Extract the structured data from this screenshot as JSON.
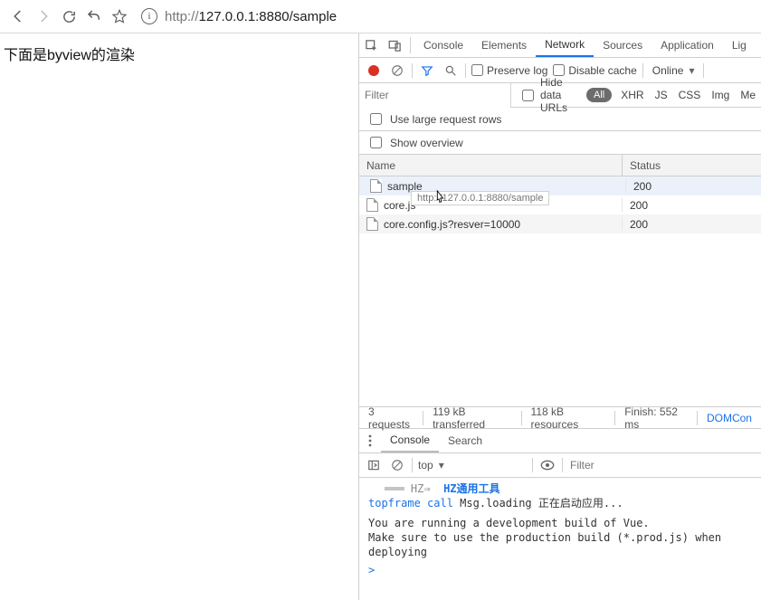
{
  "browser": {
    "url_protocol": "http://",
    "url_rest": "127.0.0.1:8880/sample"
  },
  "page": {
    "body_text": "下面是byview的渲染"
  },
  "devtools": {
    "tabs": {
      "console": "Console",
      "elements": "Elements",
      "network": "Network",
      "sources": "Sources",
      "application": "Application",
      "lighthouse": "Lig"
    },
    "toolbar": {
      "preserve_log": "Preserve log",
      "disable_cache": "Disable cache",
      "throttle": "Online"
    },
    "filter": {
      "placeholder": "Filter",
      "hide_data_urls": "Hide data URLs",
      "pill_all": "All",
      "type_xhr": "XHR",
      "type_js": "JS",
      "type_css": "CSS",
      "type_img": "Img",
      "type_media": "Me"
    },
    "options": {
      "use_large": "Use large request rows",
      "show_overview": "Show overview"
    },
    "net_headers": {
      "name": "Name",
      "status": "Status"
    },
    "net_rows": [
      {
        "name": "sample",
        "status": "200"
      },
      {
        "name": "core.js",
        "status": "200"
      },
      {
        "name": "core.config.js?resver=10000",
        "status": "200"
      }
    ],
    "tooltip": "http://127.0.0.1:8880/sample",
    "summary": {
      "requests": "3 requests",
      "transferred": "119 kB transferred",
      "resources": "118 kB resources",
      "finish": "Finish: 552 ms",
      "domcontent": "DOMCon"
    },
    "drawer": {
      "tabs": {
        "console": "Console",
        "search": "Search"
      },
      "context": "top",
      "filter_placeholder": "Filter",
      "line1_eq": "═══",
      "line1_hz": "HZ⇒",
      "line1_label": "HZ通用工具",
      "line2_a": "topframe",
      "line2_b": "call",
      "line2_c": "Msg.loading 正在启动应用...",
      "line3": "You are running a development build of Vue.",
      "line4": "Make sure to use the production build (*.prod.js) when deploying",
      "prompt": ">"
    }
  }
}
